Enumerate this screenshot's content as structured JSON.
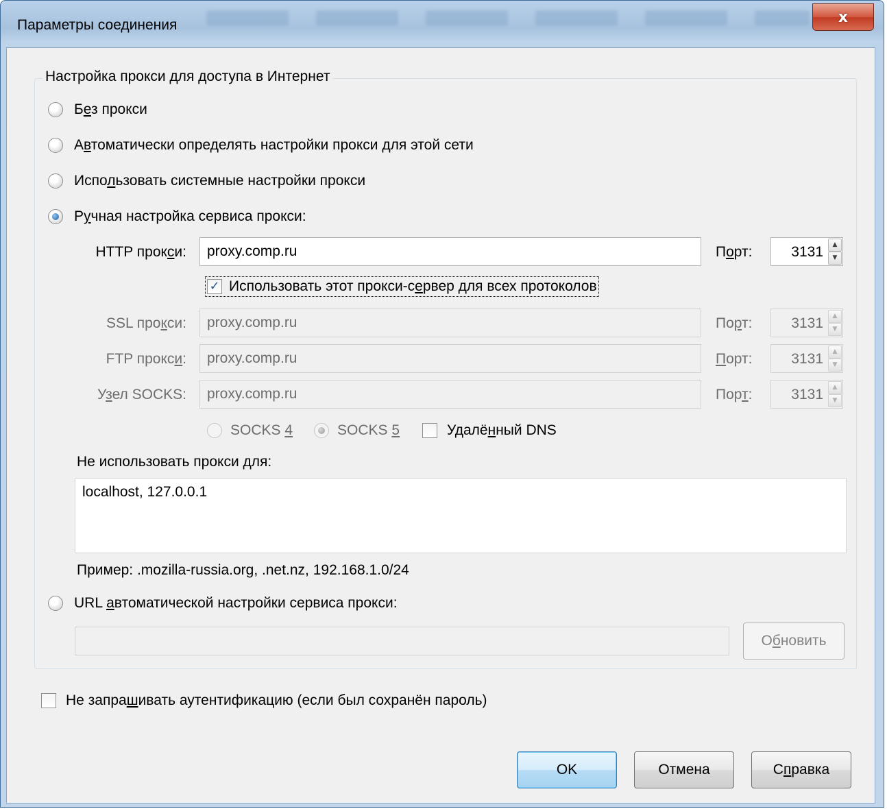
{
  "window": {
    "title": "Параметры соединения",
    "close_label": "x"
  },
  "proxy_group": {
    "legend": "Настройка прокси для доступа в Интернет",
    "options": [
      {
        "pre": "Б",
        "u": "е",
        "post": "з прокси",
        "checked": false
      },
      {
        "pre": "А",
        "u": "в",
        "post": "томатически определять настройки прокси для этой сети",
        "checked": false
      },
      {
        "pre": "Испо",
        "u": "л",
        "post": "ьзовать системные настройки прокси",
        "checked": false
      },
      {
        "pre": "Р",
        "u": "у",
        "post": "чная настройка сервиса прокси:",
        "checked": true
      }
    ],
    "http": {
      "label_pre": "HTTP прок",
      "label_u": "с",
      "label_post": "и:",
      "value": "proxy.comp.ru",
      "port_pre": "П",
      "port_u": "о",
      "port_post": "рт:",
      "port": "3131"
    },
    "use_for_all": {
      "pre": "Использовать этот прокси-с",
      "u": "е",
      "post": "рвер для всех протоколов",
      "checked": true
    },
    "ssl": {
      "label_pre": "SSL про",
      "label_u": "к",
      "label_post": "си:",
      "value": "proxy.comp.ru",
      "port_pre": "По",
      "port_u": "р",
      "port_post": "т:",
      "port": "3131"
    },
    "ftp": {
      "label_pre": "FTP прокс",
      "label_u": "и",
      "label_post": ":",
      "value": "proxy.comp.ru",
      "port_pre": "",
      "port_u": "П",
      "port_post": "орт:",
      "port": "3131"
    },
    "socks": {
      "label_pre": "У",
      "label_u": "з",
      "label_post": "ел SOCKS:",
      "value": "proxy.comp.ru",
      "port_pre": "Пор",
      "port_u": "т",
      "port_post": ":",
      "port": "3131"
    },
    "socks4": {
      "pre": "SOCKS ",
      "u": "4",
      "checked": false
    },
    "socks5": {
      "pre": "SOCKS ",
      "u": "5",
      "checked": true
    },
    "remote_dns": {
      "pre": "Удалё",
      "u": "н",
      "post": "ный DNS",
      "checked": false
    },
    "no_proxy": {
      "pre": "Не использовать прокси ",
      "u": "д",
      "post": "ля:",
      "value": "localhost, 127.0.0.1"
    },
    "example": "Пример: .mozilla-russia.org, .net.nz, 192.168.1.0/24",
    "auto_url": {
      "pre": "URL ",
      "u": "а",
      "post": "втоматической настройки сервиса прокси:",
      "checked": false,
      "value": ""
    },
    "reload": {
      "pre": "О",
      "u": "б",
      "post": "новить"
    }
  },
  "no_auth": {
    "pre": "Не запра",
    "u": "ш",
    "post": "ивать аутентификацию (если был сохранён пароль)",
    "checked": false
  },
  "buttons": {
    "ok": "OK",
    "cancel": "Отмена",
    "help_pre": "С",
    "help_u": "п",
    "help_post": "равка"
  },
  "colors": {
    "title_bar": "#b9d1ea",
    "close_button": "#c13a22",
    "dialog_bg": "#f0f0f0",
    "default_button": "#a5d3f2"
  }
}
